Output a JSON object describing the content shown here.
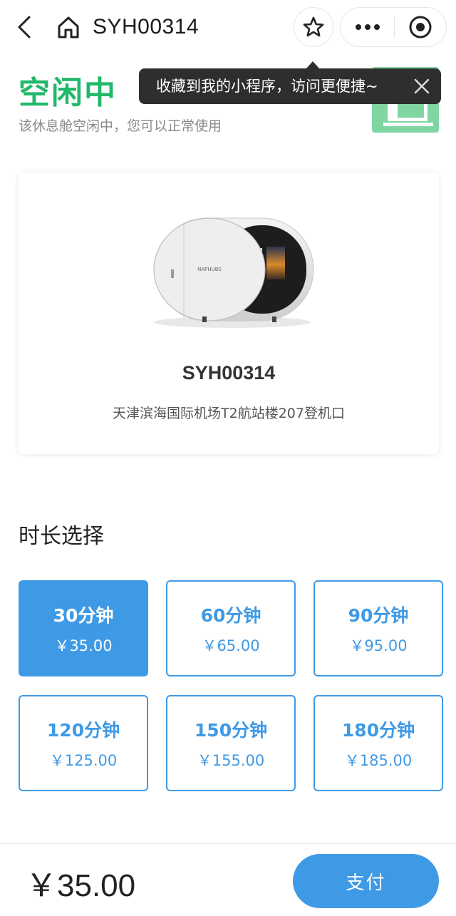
{
  "nav": {
    "title": "SYH00314",
    "icons": [
      "back-icon",
      "home-icon",
      "star-icon",
      "more-icon",
      "record-icon"
    ]
  },
  "tooltip": {
    "text": "收藏到我的小程序，访问更便捷~"
  },
  "status": {
    "title": "空闲中",
    "subtitle": "该休息舱空闲中，您可以正常使用",
    "color": "#21b86a"
  },
  "device": {
    "code": "SYH00314",
    "location": "天津滨海国际机场T2航站楼207登机口"
  },
  "duration": {
    "title": "时长选择",
    "selected_index": 0,
    "options": [
      {
        "label": "30分钟",
        "price": "￥35.00"
      },
      {
        "label": "60分钟",
        "price": "￥65.00"
      },
      {
        "label": "90分钟",
        "price": "￥95.00"
      },
      {
        "label": "120分钟",
        "price": "￥125.00"
      },
      {
        "label": "150分钟",
        "price": "￥155.00"
      },
      {
        "label": "180分钟",
        "price": "￥185.00"
      }
    ]
  },
  "footer": {
    "total": "￥35.00",
    "pay_label": "支付"
  },
  "colors": {
    "accent": "#3f9ae6",
    "status_green": "#21b86a",
    "tooltip_bg": "#2e2e2e"
  }
}
